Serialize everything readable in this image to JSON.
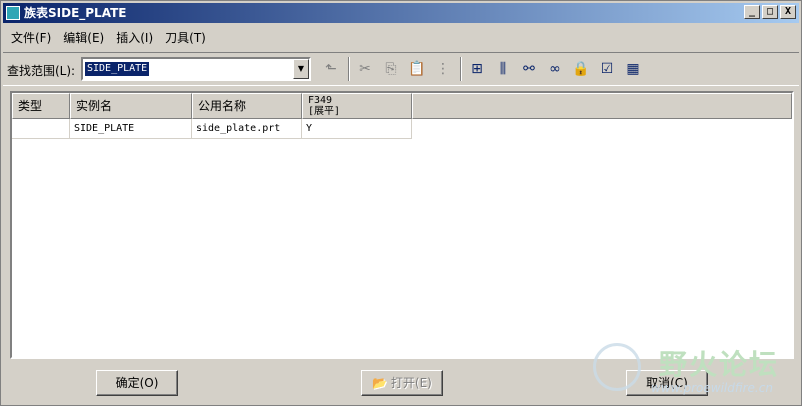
{
  "window": {
    "title": "族表SIDE_PLATE",
    "minimize": "_",
    "maximize": "□",
    "close": "X"
  },
  "menu": [
    "文件(F)",
    "编辑(E)",
    "插入(I)",
    "刀具(T)"
  ],
  "toolbar": {
    "find_label": "查找范围(L):",
    "find_value": "SIDE_PLATE",
    "icons": [
      {
        "name": "up-folder-icon",
        "glyph": "⬑",
        "enabled": false
      },
      {
        "name": "cut-icon",
        "glyph": "✂",
        "enabled": false
      },
      {
        "name": "copy-icon",
        "glyph": "⎘",
        "enabled": false
      },
      {
        "name": "paste-icon",
        "glyph": "📋",
        "enabled": false
      },
      {
        "name": "pattern-icon",
        "glyph": "⋮",
        "enabled": false
      },
      {
        "name": "insert-instance-icon",
        "glyph": "⊞",
        "enabled": true
      },
      {
        "name": "insert-column-icon",
        "glyph": "⫼",
        "enabled": true
      },
      {
        "name": "binoculars-icon",
        "glyph": "⚯",
        "enabled": true
      },
      {
        "name": "glasses-icon",
        "glyph": "∞",
        "enabled": true
      },
      {
        "name": "lock-icon",
        "glyph": "🔒",
        "enabled": true
      },
      {
        "name": "verify-icon",
        "glyph": "☑",
        "enabled": true
      },
      {
        "name": "table-icon",
        "glyph": "▦",
        "enabled": true
      }
    ]
  },
  "table": {
    "headers": [
      "类型",
      "实例名",
      "公用名称",
      "F349\n[展平]"
    ],
    "rows": [
      [
        "",
        "SIDE_PLATE",
        "side_plate.prt",
        "Y"
      ]
    ]
  },
  "footer": {
    "ok": "确定(O)",
    "open": "打开(E)",
    "cancel": "取消(C)"
  },
  "watermark": {
    "cn": "野火论坛",
    "url": "www.proewildfire.cn"
  }
}
